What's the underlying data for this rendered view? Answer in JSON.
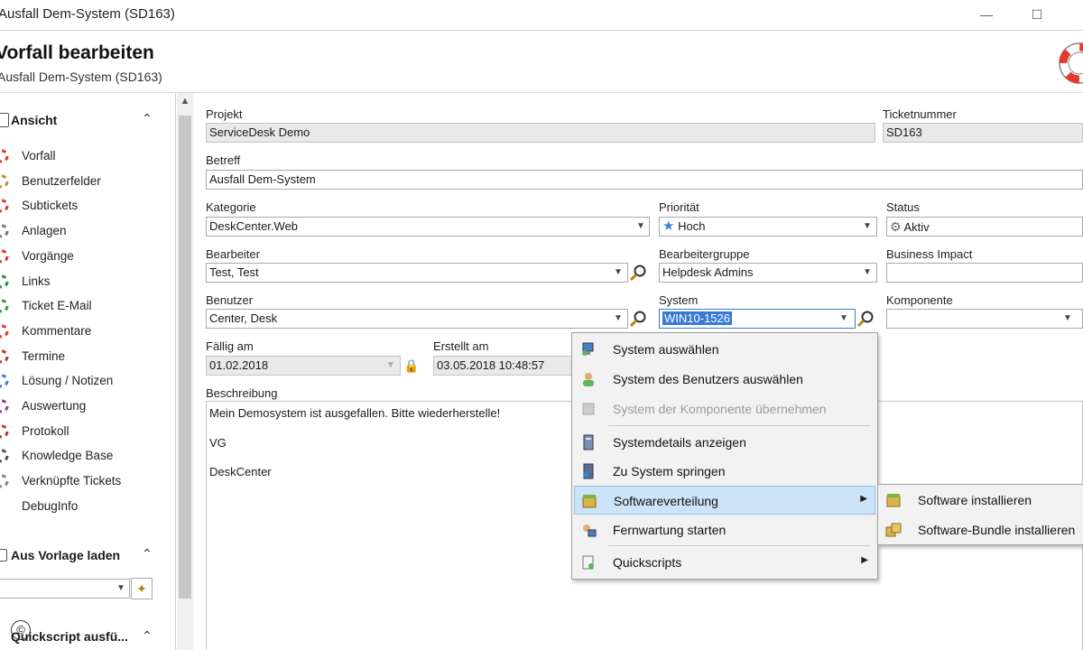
{
  "window": {
    "title": "Ausfall Dem-System   (SD163)"
  },
  "header": {
    "title": "Vorfall bearbeiten",
    "subtitle": "Ausfall Dem-System   (SD163)"
  },
  "sidebar": {
    "view_section": "Ansicht",
    "items": [
      {
        "label": "Vorfall",
        "icon": "lifebuoy-icon"
      },
      {
        "label": "Benutzerfelder",
        "icon": "users-icon"
      },
      {
        "label": "Subtickets",
        "icon": "lifebuoy-icon"
      },
      {
        "label": "Anlagen",
        "icon": "paperclip-icon"
      },
      {
        "label": "Vorgänge",
        "icon": "lifebuoy-icon"
      },
      {
        "label": "Links",
        "icon": "globe-icon"
      },
      {
        "label": "Ticket E-Mail",
        "icon": "mail-icon"
      },
      {
        "label": "Kommentare",
        "icon": "lifebuoy-icon"
      },
      {
        "label": "Termine",
        "icon": "calendar-icon"
      },
      {
        "label": "Lösung / Notizen",
        "icon": "notes-icon"
      },
      {
        "label": "Auswertung",
        "icon": "chart-icon"
      },
      {
        "label": "Protokoll",
        "icon": "log-icon"
      },
      {
        "label": "Knowledge Base",
        "icon": "book-icon"
      },
      {
        "label": "Verknüpfte Tickets",
        "icon": "link-icon"
      },
      {
        "label": "DebugInfo",
        "icon": ""
      }
    ],
    "template_section": "Aus Vorlage laden",
    "quickscript_section": "Quickscript ausfü..."
  },
  "form": {
    "projekt_label": "Projekt",
    "projekt_value": "ServiceDesk Demo",
    "ticket_label": "Ticketnummer",
    "ticket_value": "SD163",
    "betreff_label": "Betreff",
    "betreff_value": "Ausfall Dem-System",
    "kategorie_label": "Kategorie",
    "kategorie_value": "DeskCenter.Web",
    "prioritaet_label": "Priorität",
    "prioritaet_value": "Hoch",
    "status_label": "Status",
    "status_value": "Aktiv",
    "bearbeiter_label": "Bearbeiter",
    "bearbeiter_value": "Test, Test",
    "gruppe_label": "Bearbeitergruppe",
    "gruppe_value": "Helpdesk Admins",
    "impact_label": "Business Impact",
    "impact_value": "",
    "benutzer_label": "Benutzer",
    "benutzer_value": "Center, Desk",
    "system_label": "System",
    "system_value": "WIN10-1526",
    "komponente_label": "Komponente",
    "komponente_value": "",
    "faellig_label": "Fällig am",
    "faellig_value": "01.02.2018",
    "erstellt_label": "Erstellt am",
    "erstellt_value": "03.05.2018 10:48:57",
    "beschreibung_label": "Beschreibung",
    "beschreibung_lines": [
      "Mein Demosystem ist ausgefallen. Bitte wiederherstelle!",
      "VG",
      "DeskCenter"
    ]
  },
  "context_menu": {
    "items": [
      {
        "label": "System auswählen"
      },
      {
        "label": "System des Benutzers auswählen"
      },
      {
        "label": "System der Komponente übernehmen"
      },
      {
        "label": "Systemdetails anzeigen"
      },
      {
        "label": "Zu System springen"
      },
      {
        "label": "Softwareverteilung"
      },
      {
        "label": "Fernwartung starten"
      },
      {
        "label": "Quickscripts"
      }
    ],
    "submenu": [
      {
        "label": "Software installieren"
      },
      {
        "label": "Software-Bundle installieren"
      }
    ]
  },
  "watermark": "©"
}
